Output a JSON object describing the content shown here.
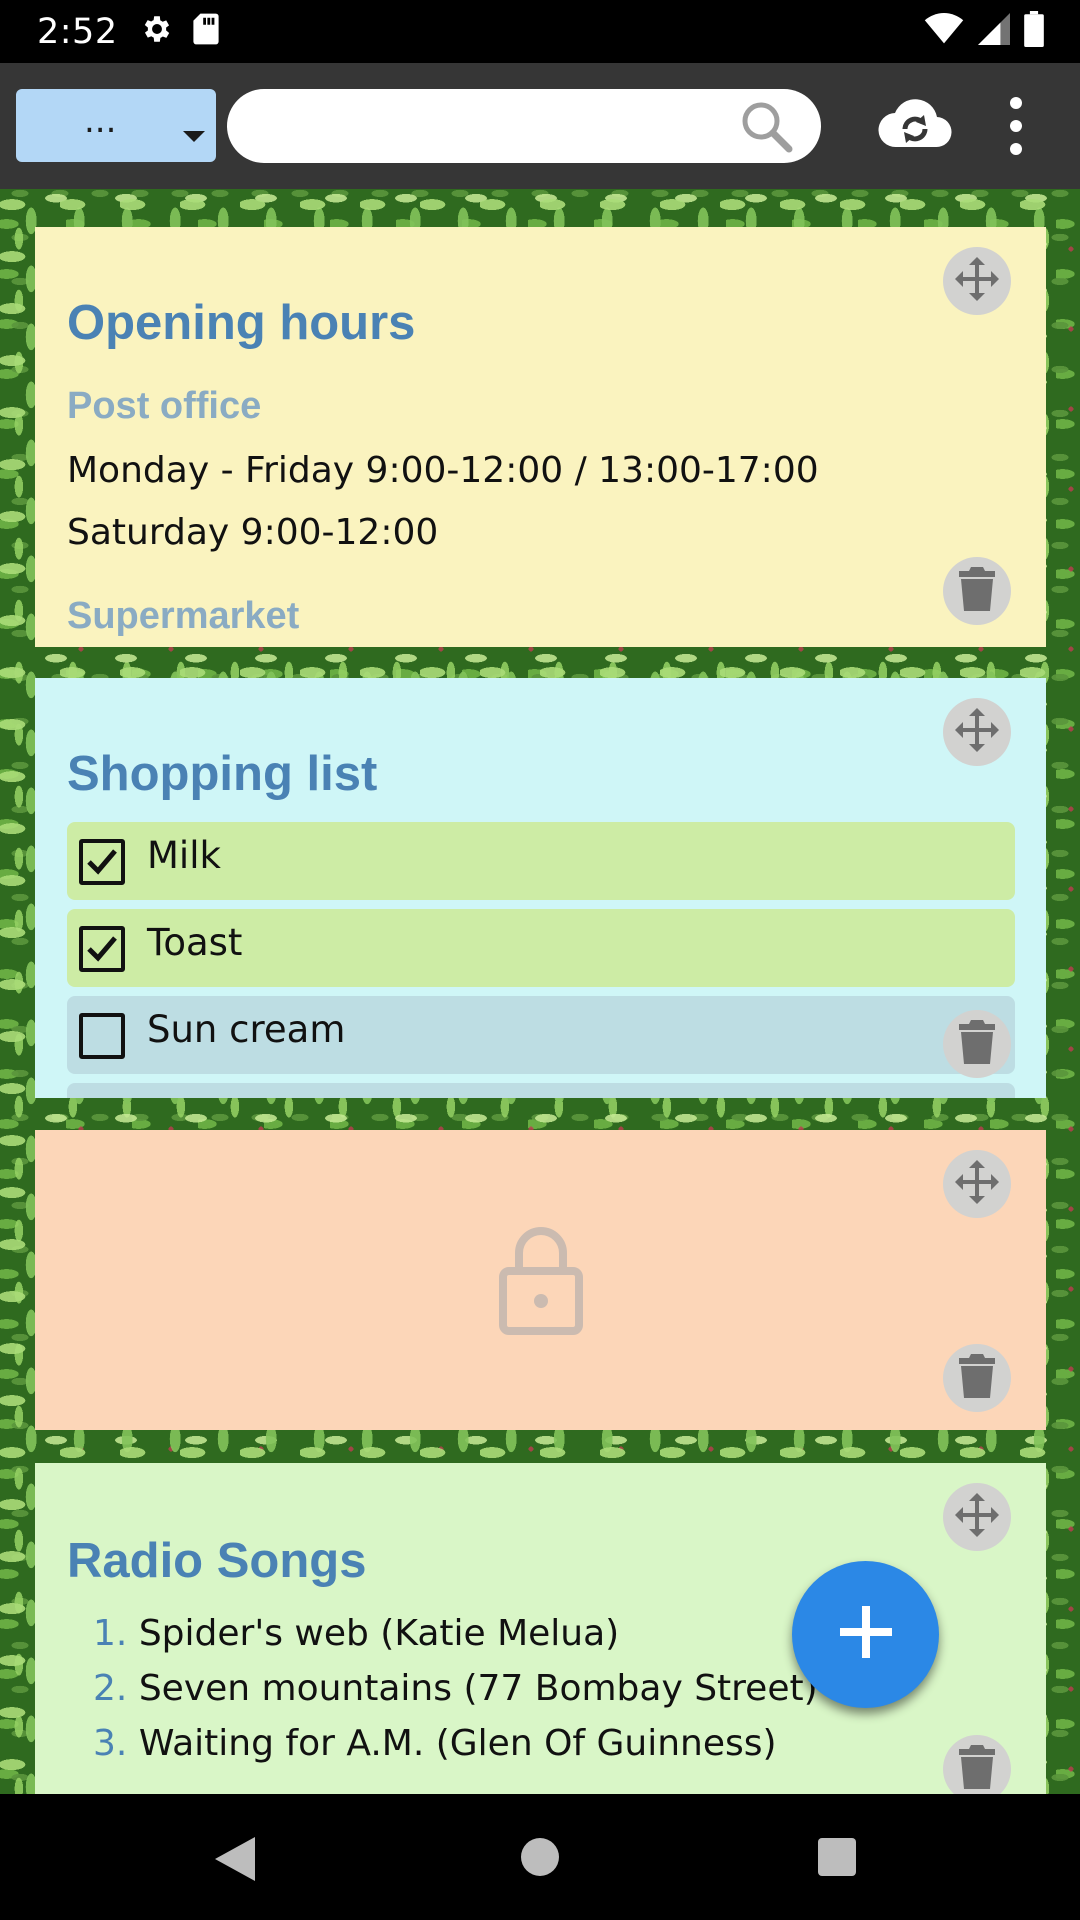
{
  "status_bar": {
    "time": "2:52",
    "icons_left": [
      "gear-icon",
      "sd-card-icon"
    ],
    "icons_right": [
      "wifi-icon",
      "cell-signal-icon",
      "battery-icon"
    ]
  },
  "toolbar": {
    "dropdown_value": "...",
    "search_value": "",
    "search_placeholder": "",
    "sync_icon": "cloud-sync-icon",
    "overflow_icon": "more-vert-icon"
  },
  "notes": {
    "opening_hours": {
      "title": "Opening hours",
      "subtitle_1": "Post office",
      "line_1": "Monday - Friday 9:00-12:00 / 13:00-17:00",
      "line_2": "Saturday 9:00-12:00",
      "subtitle_2": "Supermarket",
      "color": "#faf3bf"
    },
    "shopping_list": {
      "title": "Shopping list",
      "items": [
        {
          "label": "Milk",
          "checked": true
        },
        {
          "label": "Toast",
          "checked": true
        },
        {
          "label": "Sun cream",
          "checked": false
        }
      ],
      "color": "#cff6f7"
    },
    "locked_note": {
      "icon": "lock-icon",
      "color": "#fcd6b8"
    },
    "radio_songs": {
      "title": "Radio Songs",
      "songs": [
        {
          "num": "1.",
          "text": "Spider's web (Katie Melua)"
        },
        {
          "num": "2.",
          "text": "Seven mountains (77 Bombay Street)"
        },
        {
          "num": "3.",
          "text": "Waiting for A.M. (Glen Of Guinness)"
        }
      ],
      "color": "#d9f6c7"
    }
  },
  "fab": {
    "icon": "plus-icon",
    "color": "#2b88e6"
  },
  "accent_color": "#4a82b4"
}
